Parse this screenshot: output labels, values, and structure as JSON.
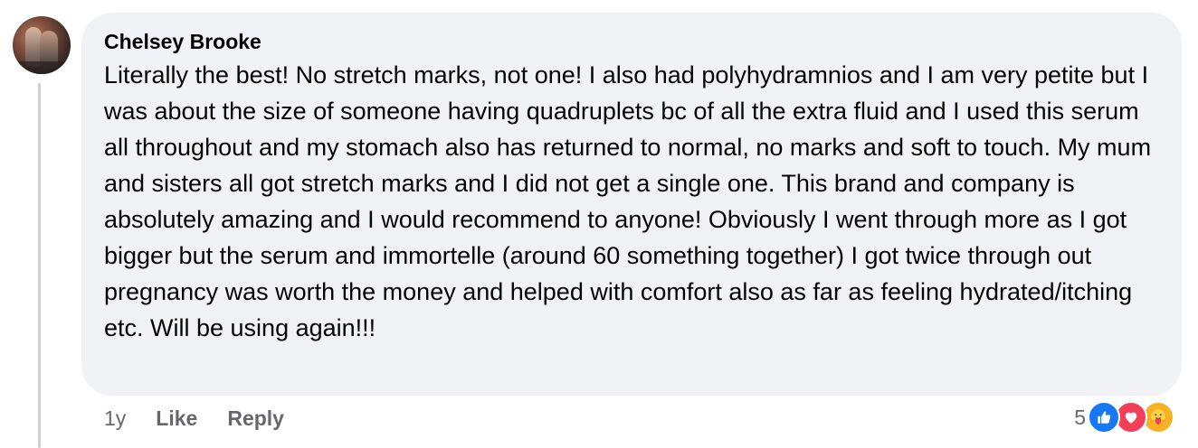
{
  "comment": {
    "author": "Chelsey Brooke",
    "text": "Literally the best! No stretch marks, not one! I also had polyhydramnios and I am very petite but I was about the size of someone having quadruplets bc of all the extra fluid and I used this serum all throughout and my stomach also has returned to normal, no marks and soft to touch. My mum and sisters all got stretch marks and I did not get a single one. This brand and company is absolutely amazing and I would recommend to anyone! Obviously I went through more as I got bigger but the serum and immortelle (around 60 something together) I got twice through out pregnancy was worth the money and helped with comfort also as far as feeling hydrated/itching etc. Will be using again!!!",
    "timestamp": "1y",
    "like_label": "Like",
    "reply_label": "Reply",
    "reaction_count": "5",
    "reactions": [
      "like-icon",
      "love-icon",
      "care-icon"
    ]
  },
  "colors": {
    "bubble_bg": "#f0f2f5",
    "meta_text": "#65676b",
    "like_blue": "#1877f2",
    "love_red": "#f33e58",
    "care_yellow": "#f7b125"
  }
}
